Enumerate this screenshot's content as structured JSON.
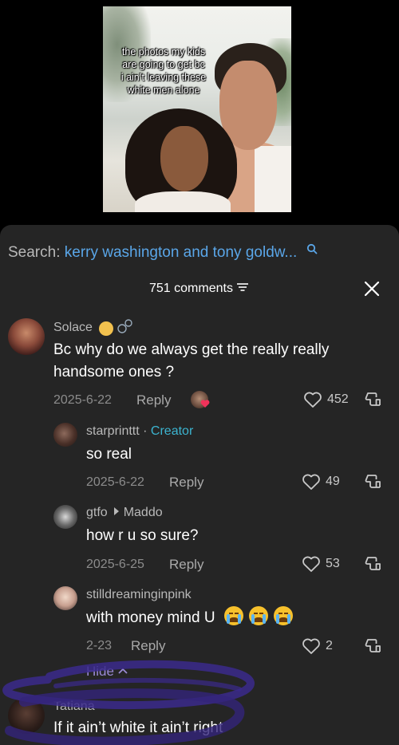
{
  "video": {
    "caption": "the photos my kids\nare going to get bc\ni ain’t leaving these\nwhite men alone"
  },
  "search": {
    "label": "Search:",
    "query": "kerry washington and tony goldw..."
  },
  "header": {
    "comment_count": "751 comments"
  },
  "comments": [
    {
      "username": "Solace",
      "text": "Bc why do we always get the really really handsome ones ?",
      "date": "2025-6-22",
      "reply_label": "Reply",
      "likes": "452"
    },
    {
      "username": "starprinttt",
      "tag_separator": "·",
      "tag": "Creator",
      "text": "so real",
      "date": "2025-6-22",
      "reply_label": "Reply",
      "likes": "49"
    },
    {
      "username": "gtfo",
      "reply_to": "Maddo",
      "text": "how r u so sure?",
      "date": "2025-6-25",
      "reply_label": "Reply",
      "likes": "53"
    },
    {
      "username": "stilldreaminginpink",
      "text": "with money mind U",
      "date": "2-23",
      "reply_label": "Reply",
      "likes": "2"
    },
    {
      "username": "Tatiana",
      "text": "If it ain’t white it ain’t right"
    }
  ],
  "hide_label": "Hide",
  "colors": {
    "sheet_bg": "#252525",
    "link_blue": "#5aa6e8",
    "creator_teal": "#3cb4d0",
    "scribble_purple": "#3b2a8c"
  }
}
